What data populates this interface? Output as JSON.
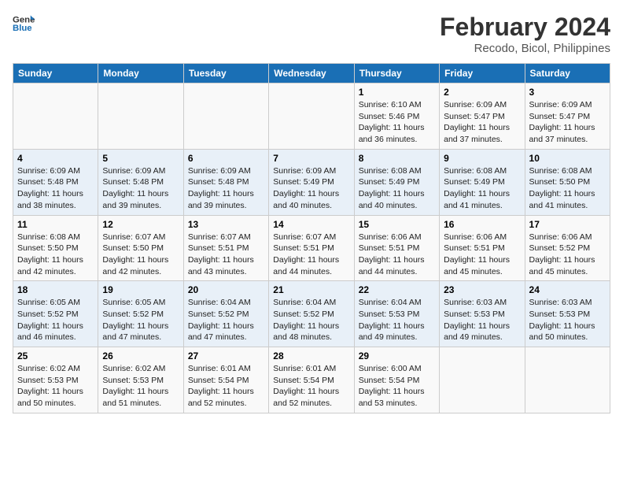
{
  "header": {
    "logo_line1": "General",
    "logo_line2": "Blue",
    "title": "February 2024",
    "subtitle": "Recodo, Bicol, Philippines"
  },
  "weekdays": [
    "Sunday",
    "Monday",
    "Tuesday",
    "Wednesday",
    "Thursday",
    "Friday",
    "Saturday"
  ],
  "weeks": [
    [
      {
        "day": "",
        "sunrise": "",
        "sunset": "",
        "daylight": ""
      },
      {
        "day": "",
        "sunrise": "",
        "sunset": "",
        "daylight": ""
      },
      {
        "day": "",
        "sunrise": "",
        "sunset": "",
        "daylight": ""
      },
      {
        "day": "",
        "sunrise": "",
        "sunset": "",
        "daylight": ""
      },
      {
        "day": "1",
        "sunrise": "Sunrise: 6:10 AM",
        "sunset": "Sunset: 5:46 PM",
        "daylight": "Daylight: 11 hours and 36 minutes."
      },
      {
        "day": "2",
        "sunrise": "Sunrise: 6:09 AM",
        "sunset": "Sunset: 5:47 PM",
        "daylight": "Daylight: 11 hours and 37 minutes."
      },
      {
        "day": "3",
        "sunrise": "Sunrise: 6:09 AM",
        "sunset": "Sunset: 5:47 PM",
        "daylight": "Daylight: 11 hours and 37 minutes."
      }
    ],
    [
      {
        "day": "4",
        "sunrise": "Sunrise: 6:09 AM",
        "sunset": "Sunset: 5:48 PM",
        "daylight": "Daylight: 11 hours and 38 minutes."
      },
      {
        "day": "5",
        "sunrise": "Sunrise: 6:09 AM",
        "sunset": "Sunset: 5:48 PM",
        "daylight": "Daylight: 11 hours and 39 minutes."
      },
      {
        "day": "6",
        "sunrise": "Sunrise: 6:09 AM",
        "sunset": "Sunset: 5:48 PM",
        "daylight": "Daylight: 11 hours and 39 minutes."
      },
      {
        "day": "7",
        "sunrise": "Sunrise: 6:09 AM",
        "sunset": "Sunset: 5:49 PM",
        "daylight": "Daylight: 11 hours and 40 minutes."
      },
      {
        "day": "8",
        "sunrise": "Sunrise: 6:08 AM",
        "sunset": "Sunset: 5:49 PM",
        "daylight": "Daylight: 11 hours and 40 minutes."
      },
      {
        "day": "9",
        "sunrise": "Sunrise: 6:08 AM",
        "sunset": "Sunset: 5:49 PM",
        "daylight": "Daylight: 11 hours and 41 minutes."
      },
      {
        "day": "10",
        "sunrise": "Sunrise: 6:08 AM",
        "sunset": "Sunset: 5:50 PM",
        "daylight": "Daylight: 11 hours and 41 minutes."
      }
    ],
    [
      {
        "day": "11",
        "sunrise": "Sunrise: 6:08 AM",
        "sunset": "Sunset: 5:50 PM",
        "daylight": "Daylight: 11 hours and 42 minutes."
      },
      {
        "day": "12",
        "sunrise": "Sunrise: 6:07 AM",
        "sunset": "Sunset: 5:50 PM",
        "daylight": "Daylight: 11 hours and 42 minutes."
      },
      {
        "day": "13",
        "sunrise": "Sunrise: 6:07 AM",
        "sunset": "Sunset: 5:51 PM",
        "daylight": "Daylight: 11 hours and 43 minutes."
      },
      {
        "day": "14",
        "sunrise": "Sunrise: 6:07 AM",
        "sunset": "Sunset: 5:51 PM",
        "daylight": "Daylight: 11 hours and 44 minutes."
      },
      {
        "day": "15",
        "sunrise": "Sunrise: 6:06 AM",
        "sunset": "Sunset: 5:51 PM",
        "daylight": "Daylight: 11 hours and 44 minutes."
      },
      {
        "day": "16",
        "sunrise": "Sunrise: 6:06 AM",
        "sunset": "Sunset: 5:51 PM",
        "daylight": "Daylight: 11 hours and 45 minutes."
      },
      {
        "day": "17",
        "sunrise": "Sunrise: 6:06 AM",
        "sunset": "Sunset: 5:52 PM",
        "daylight": "Daylight: 11 hours and 45 minutes."
      }
    ],
    [
      {
        "day": "18",
        "sunrise": "Sunrise: 6:05 AM",
        "sunset": "Sunset: 5:52 PM",
        "daylight": "Daylight: 11 hours and 46 minutes."
      },
      {
        "day": "19",
        "sunrise": "Sunrise: 6:05 AM",
        "sunset": "Sunset: 5:52 PM",
        "daylight": "Daylight: 11 hours and 47 minutes."
      },
      {
        "day": "20",
        "sunrise": "Sunrise: 6:04 AM",
        "sunset": "Sunset: 5:52 PM",
        "daylight": "Daylight: 11 hours and 47 minutes."
      },
      {
        "day": "21",
        "sunrise": "Sunrise: 6:04 AM",
        "sunset": "Sunset: 5:52 PM",
        "daylight": "Daylight: 11 hours and 48 minutes."
      },
      {
        "day": "22",
        "sunrise": "Sunrise: 6:04 AM",
        "sunset": "Sunset: 5:53 PM",
        "daylight": "Daylight: 11 hours and 49 minutes."
      },
      {
        "day": "23",
        "sunrise": "Sunrise: 6:03 AM",
        "sunset": "Sunset: 5:53 PM",
        "daylight": "Daylight: 11 hours and 49 minutes."
      },
      {
        "day": "24",
        "sunrise": "Sunrise: 6:03 AM",
        "sunset": "Sunset: 5:53 PM",
        "daylight": "Daylight: 11 hours and 50 minutes."
      }
    ],
    [
      {
        "day": "25",
        "sunrise": "Sunrise: 6:02 AM",
        "sunset": "Sunset: 5:53 PM",
        "daylight": "Daylight: 11 hours and 50 minutes."
      },
      {
        "day": "26",
        "sunrise": "Sunrise: 6:02 AM",
        "sunset": "Sunset: 5:53 PM",
        "daylight": "Daylight: 11 hours and 51 minutes."
      },
      {
        "day": "27",
        "sunrise": "Sunrise: 6:01 AM",
        "sunset": "Sunset: 5:54 PM",
        "daylight": "Daylight: 11 hours and 52 minutes."
      },
      {
        "day": "28",
        "sunrise": "Sunrise: 6:01 AM",
        "sunset": "Sunset: 5:54 PM",
        "daylight": "Daylight: 11 hours and 52 minutes."
      },
      {
        "day": "29",
        "sunrise": "Sunrise: 6:00 AM",
        "sunset": "Sunset: 5:54 PM",
        "daylight": "Daylight: 11 hours and 53 minutes."
      },
      {
        "day": "",
        "sunrise": "",
        "sunset": "",
        "daylight": ""
      },
      {
        "day": "",
        "sunrise": "",
        "sunset": "",
        "daylight": ""
      }
    ]
  ]
}
